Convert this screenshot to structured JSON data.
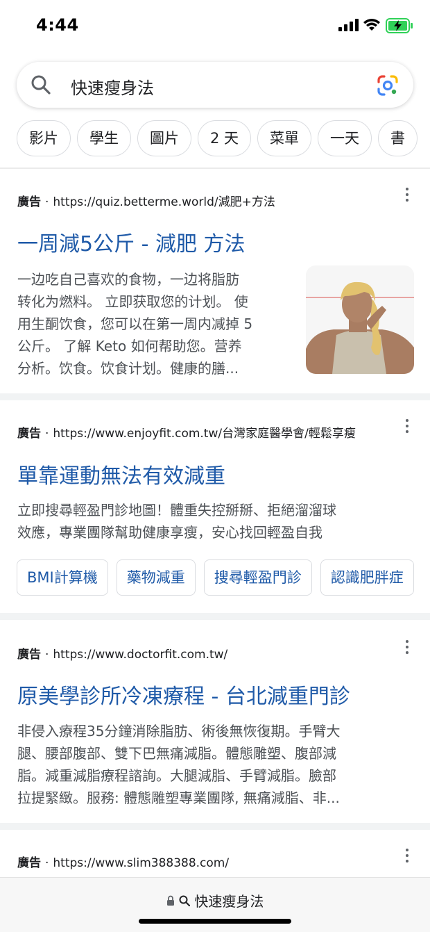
{
  "status_bar": {
    "time": "4:44",
    "battery_color": "#30d158"
  },
  "search": {
    "query": "快速瘦身法"
  },
  "chips": [
    "影片",
    "學生",
    "圖片",
    "2 天",
    "菜單",
    "一天",
    "書"
  ],
  "results": [
    {
      "sponsor_label": "廣告",
      "url": "https://quiz.betterme.world/減肥+方法",
      "title": "一周減5公斤 - 減肥 方法",
      "body_lines": [
        "一边吃自己喜欢的食物，一边将脂肪",
        "转化为燃料。 立即获取您的计划。 使",
        "用生酮饮食，您可以在第一周内减掉 5",
        "公斤。 了解 Keto 如何帮助您。营养",
        "分析。饮食。饮食计划。健康的膳..."
      ]
    },
    {
      "sponsor_label": "廣告",
      "url": "https://www.enjoyfit.com.tw/台灣家庭醫學會/輕鬆享瘦",
      "title": "單靠運動無法有效減重",
      "body_lines": [
        "立即搜尋輕盈門診地圖！體重失控掰掰、拒絕溜溜球",
        "效應，專業團隊幫助健康享瘦，安心找回輕盈自我"
      ],
      "sitelinks": [
        "BMI計算機",
        "藥物減重",
        "搜尋輕盈門診",
        "認識肥胖症"
      ]
    },
    {
      "sponsor_label": "廣告",
      "url": "https://www.doctorfit.com.tw/",
      "title": "原美學診所冷凍療程 - 台北減重門診",
      "body_lines": [
        "非侵入療程35分鐘消除脂肪、術後無恢復期。手臂大",
        "腿、腰部腹部、雙下巴無痛減脂。體態雕塑、腹部減",
        "脂。減重減脂療程諮詢。大腿減脂、手臂減脂。臉部",
        "拉提緊緻。服務: 體態雕塑專業團隊, 無痛減脂、非..."
      ]
    },
    {
      "sponsor_label": "廣告",
      "url": "https://www.slim388388.com/"
    }
  ],
  "bottom_bar": {
    "address": "快速瘦身法"
  },
  "colors": {
    "link": "#1f5aa8",
    "text": "#202124",
    "snippet": "#4d5156"
  }
}
